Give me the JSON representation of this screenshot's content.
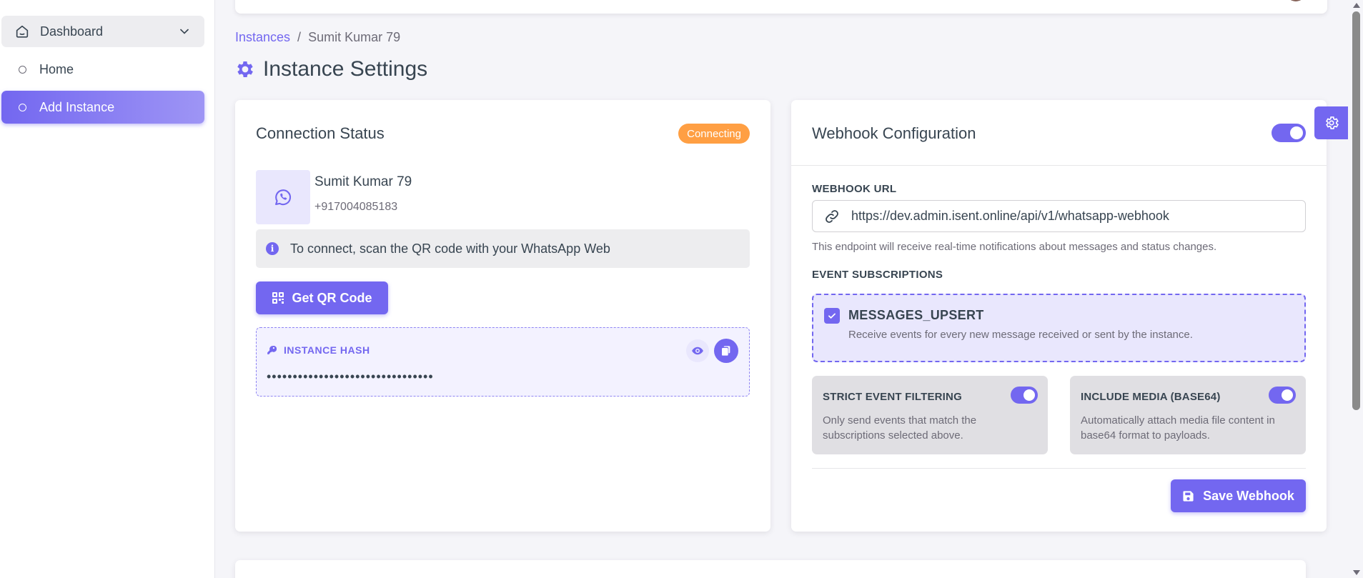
{
  "sidebar": {
    "dashboard_label": "Dashboard",
    "items": [
      {
        "label": "Home"
      },
      {
        "label": "Add Instance"
      }
    ]
  },
  "breadcrumb": {
    "parent": "Instances",
    "separator": "/",
    "current": "Sumit Kumar 79"
  },
  "page": {
    "title": "Instance Settings"
  },
  "connection": {
    "title": "Connection Status",
    "status_badge": "Connecting",
    "instance_name": "Sumit Kumar 79",
    "phone": "+917004085183",
    "info_text": "To connect, scan the QR code with your WhatsApp Web",
    "qr_button": "Get QR Code",
    "hash_label": "INSTANCE HASH",
    "hash_value": "••••••••••••••••••••••••••••••••"
  },
  "webhook": {
    "title": "Webhook Configuration",
    "enabled": true,
    "url_label": "WEBHOOK URL",
    "url_value": "https://dev.admin.isent.online/api/v1/whatsapp-webhook",
    "url_help": "This endpoint will receive real-time notifications about messages and status changes.",
    "events_label": "EVENT SUBSCRIPTIONS",
    "event": {
      "name": "MESSAGES_UPSERT",
      "description": "Receive events for every new message received or sent by the instance.",
      "checked": true
    },
    "strict_filter": {
      "title": "STRICT EVENT FILTERING",
      "description": "Only send events that match the subscriptions selected above.",
      "enabled": true
    },
    "include_media": {
      "title": "INCLUDE MEDIA (BASE64)",
      "description": "Automatically attach media file content in base64 format to payloads.",
      "enabled": true
    },
    "save_button": "Save Webhook"
  },
  "colors": {
    "primary": "#7367f0",
    "warning": "#ff9f43",
    "online": "#28c76f"
  }
}
